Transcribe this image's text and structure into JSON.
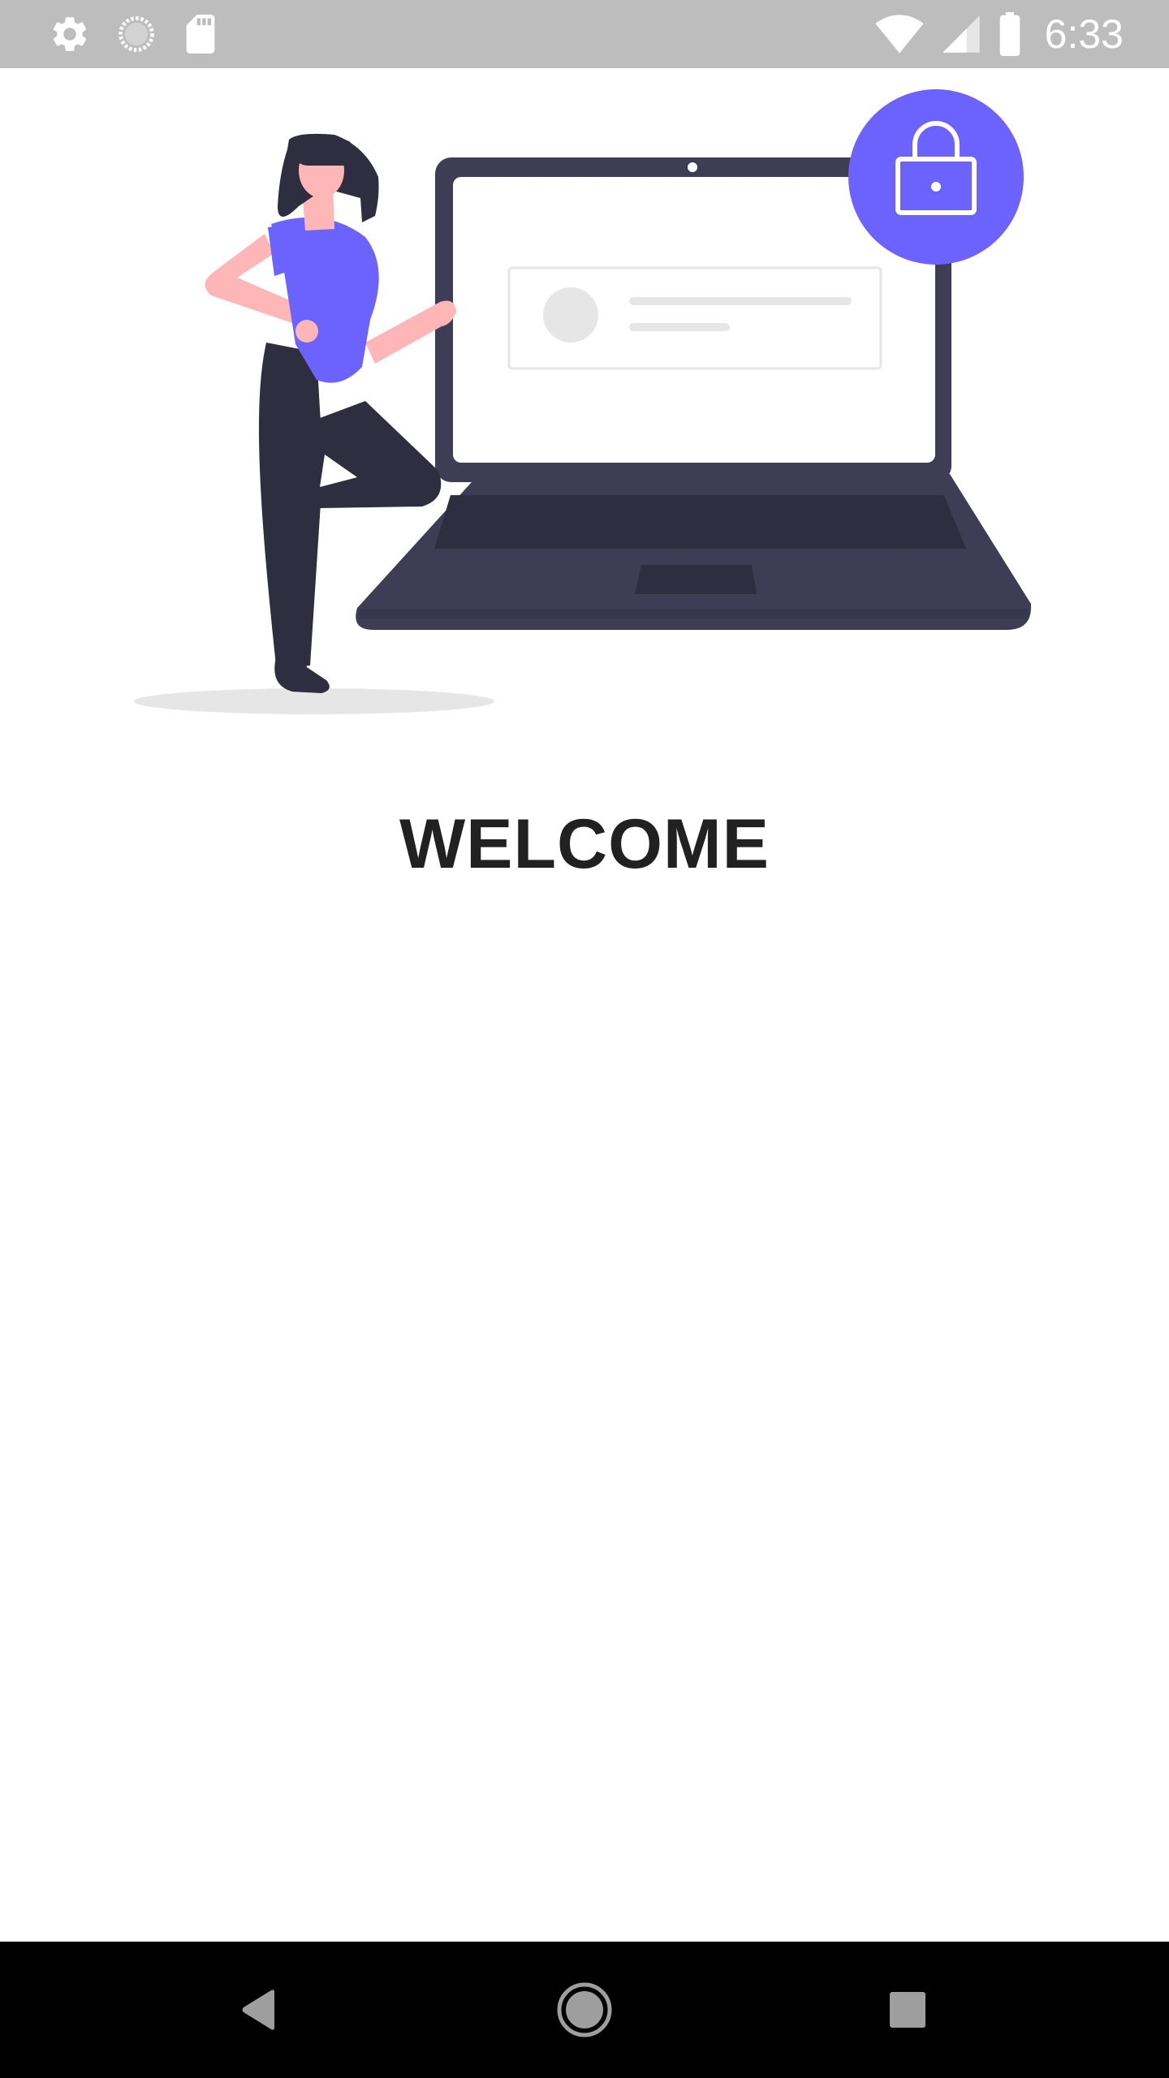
{
  "status_bar": {
    "time": "6:33",
    "background_color": "#bdbdbd",
    "left_icons": [
      "settings-gear-icon",
      "sync-circle-icon",
      "sd-card-icon"
    ],
    "right_icons": [
      "wifi-icon",
      "cellular-signal-icon",
      "battery-icon"
    ]
  },
  "hero": {
    "illustration": "woman-with-laptop-login-illustration",
    "accent_color": "#6c63ff",
    "lock_icon": "padlock-icon"
  },
  "main": {
    "title": "WELCOME",
    "title_color": "#212121"
  },
  "nav_bar": {
    "background_color": "#000000",
    "buttons": [
      "back-button",
      "home-button",
      "recents-button"
    ]
  }
}
